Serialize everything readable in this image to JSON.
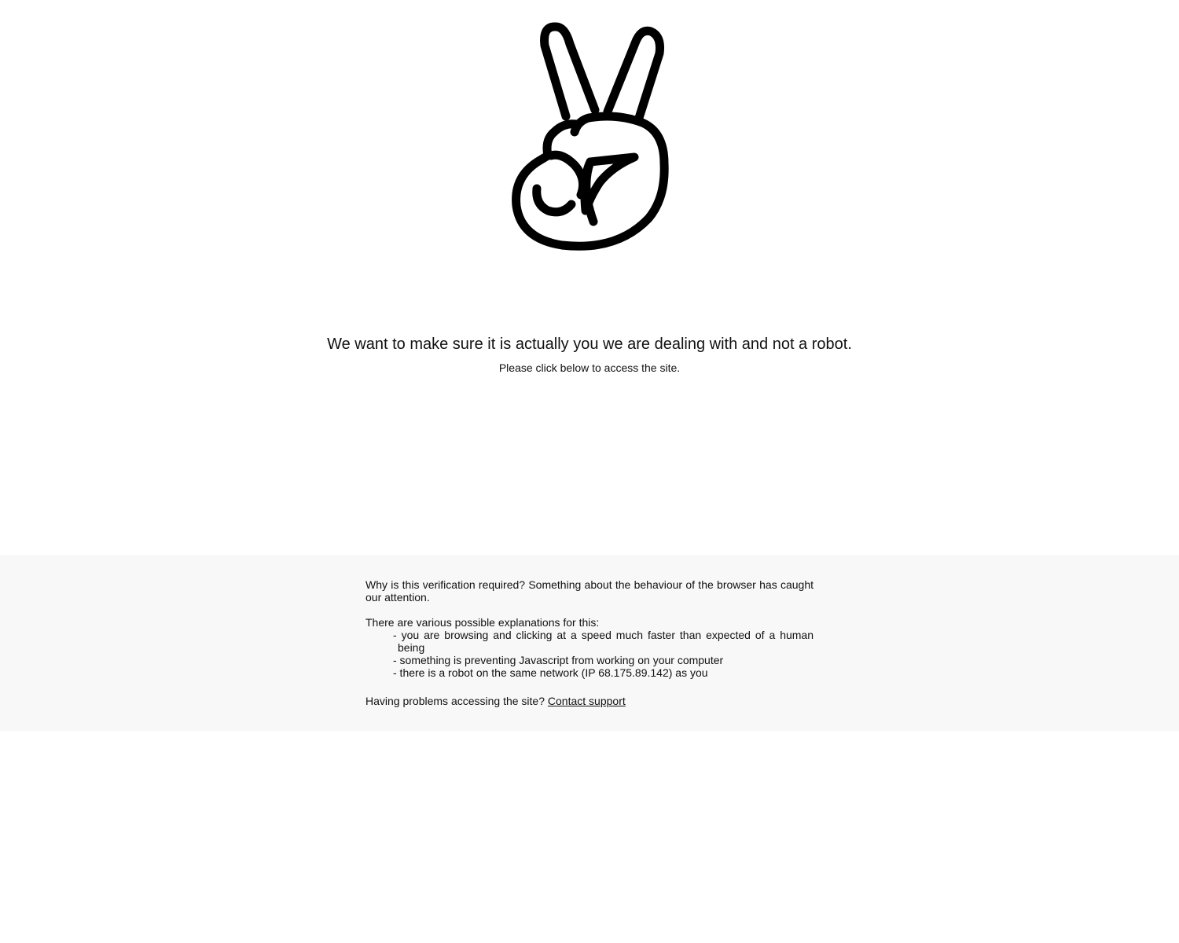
{
  "logo": {
    "icon": "peace-hand-icon",
    "color": "#000000"
  },
  "main": {
    "heading": "We want to make sure it is actually you we are dealing with and not a robot.",
    "subtext": "Please click below to access the site."
  },
  "info": {
    "background": "#f8f8f8",
    "why": "Why is this verification required? Something about the behaviour of the browser has caught our attention.",
    "intro": "There are various possible explanations for this:",
    "reasons": [
      "- you are browsing and clicking at a speed much faster than expected of a human being",
      "- something is preventing Javascript from working on your computer",
      "- there is a robot on the same network (IP 68.175.89.142) as you"
    ],
    "problems_text": "Having problems accessing the site?",
    "support_link": "Contact support"
  }
}
